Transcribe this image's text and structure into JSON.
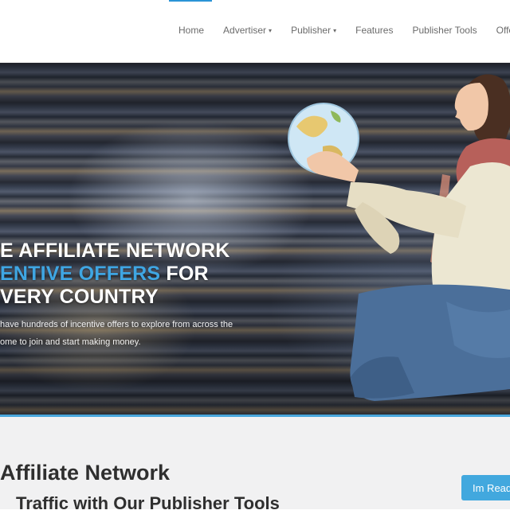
{
  "nav": {
    "items": [
      {
        "label": "Home",
        "dropdown": false
      },
      {
        "label": "Advertiser",
        "dropdown": true
      },
      {
        "label": "Publisher",
        "dropdown": true
      },
      {
        "label": "Features",
        "dropdown": false
      },
      {
        "label": "Publisher Tools",
        "dropdown": false
      },
      {
        "label": "Offers",
        "dropdown": false
      }
    ],
    "caret": "▾"
  },
  "hero": {
    "line1": "E AFFILIATE NETWORK",
    "line2_blue": "ENTIVE OFFERS",
    "line2_white": " FOR",
    "line3": "VERY COUNTRY",
    "para_line1": "have hundreds of incentive offers to explore from across the",
    "para_line2": "ome to join and start making money."
  },
  "lower": {
    "title": "Affiliate Network",
    "subtitle": "Traffic with Our Publisher Tools",
    "cta_label": "Im Read"
  },
  "colors": {
    "accent": "#3fa6e3",
    "cta": "#42a8de",
    "nav_text": "#6b6b6b"
  }
}
